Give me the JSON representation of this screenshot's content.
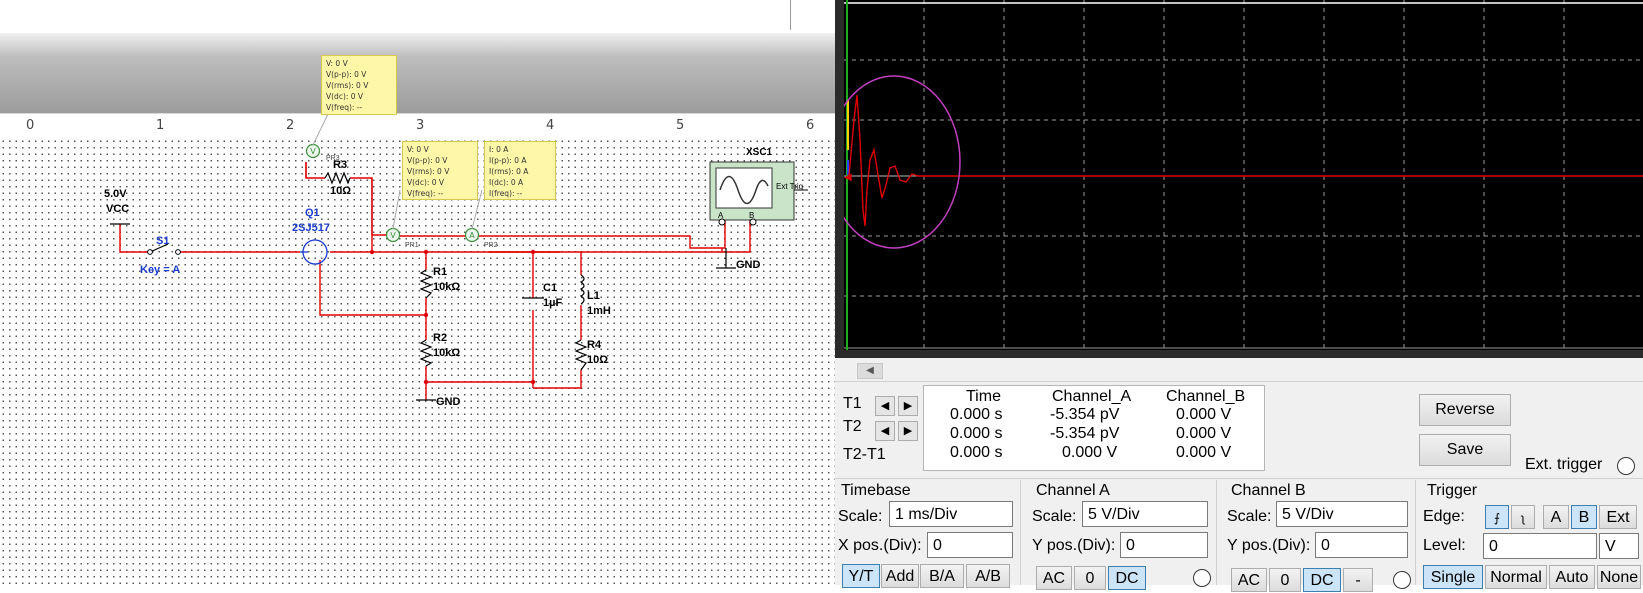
{
  "ruler": [
    "0",
    "1",
    "2",
    "3",
    "4",
    "5",
    "6"
  ],
  "probes": {
    "pr3": {
      "name": "PR3",
      "lines": [
        "V: 0 V",
        "V(p-p): 0 V",
        "V(rms): 0 V",
        "V(dc): 0 V",
        "V(freq): --"
      ]
    },
    "pr1": {
      "name": "PR1",
      "lines": [
        "V: 0 V",
        "V(p-p): 0 V",
        "V(rms): 0 V",
        "V(dc): 0 V",
        "V(freq): --"
      ]
    },
    "pr2": {
      "name": "PR2",
      "lines": [
        "I: 0 A",
        "I(p-p): 0 A",
        "I(rms): 0 A",
        "I(dc): 0 A",
        "I(freq): --"
      ]
    }
  },
  "components": {
    "vcc_value": "5.0V",
    "vcc_name": "VCC",
    "s1_name": "S1",
    "s1_key": "Key = A",
    "q1_name": "Q1",
    "q1_part": "2SJ517",
    "r3_name": "R3",
    "r3_value": "10Ω",
    "r1_name": "R1",
    "r1_value": "10kΩ",
    "r2_name": "R2",
    "r2_value": "10kΩ",
    "c1_name": "C1",
    "c1_value": "1µF",
    "l1_name": "L1",
    "l1_value": "1mH",
    "r4_name": "R4",
    "r4_value": "10Ω",
    "gnd1": "GND",
    "gnd2": "GND",
    "xsc1_name": "XSC1",
    "xsc1_ext": "Ext Trig",
    "xsc1_a": "A",
    "xsc1_b": "B"
  },
  "scope": {
    "cursor_rows": [
      "T1",
      "T2",
      "T2-T1"
    ],
    "headers": {
      "time": "Time",
      "a": "Channel_A",
      "b": "Channel_B"
    },
    "rows": [
      {
        "time": "0.000 s",
        "a": "-5.354 pV",
        "b": "0.000 V"
      },
      {
        "time": "0.000 s",
        "a": "-5.354 pV",
        "b": "0.000 V"
      },
      {
        "time": "0.000 s",
        "a": "0.000 V",
        "b": "0.000 V"
      }
    ],
    "reverse": "Reverse",
    "save": "Save",
    "ext_trigger": "Ext. trigger",
    "timebase": {
      "title": "Timebase",
      "scale_label": "Scale:",
      "scale": "1 ms/Div",
      "xpos_label": "X pos.(Div):",
      "xpos": "0",
      "modes": [
        "Y/T",
        "Add",
        "B/A",
        "A/B"
      ]
    },
    "channel_a": {
      "title": "Channel A",
      "scale_label": "Scale:",
      "scale": "5  V/Div",
      "ypos_label": "Y pos.(Div):",
      "ypos": "0",
      "coupling": [
        "AC",
        "0",
        "DC"
      ]
    },
    "channel_b": {
      "title": "Channel B",
      "scale_label": "Scale:",
      "scale": "5  V/Div",
      "ypos_label": "Y pos.(Div):",
      "ypos": "0",
      "coupling": [
        "AC",
        "0",
        "DC",
        "-"
      ]
    },
    "trigger": {
      "title": "Trigger",
      "edge_label": "Edge:",
      "level_label": "Level:",
      "level": "0",
      "level_unit": "V",
      "sources": [
        "A",
        "B",
        "Ext"
      ],
      "modes": [
        "Single",
        "Normal",
        "Auto",
        "None"
      ]
    },
    "colors": {
      "trace_a": "#e00000",
      "screen": "#000000",
      "grid": "#9a9a9a",
      "highlight": "#c040c0"
    }
  }
}
